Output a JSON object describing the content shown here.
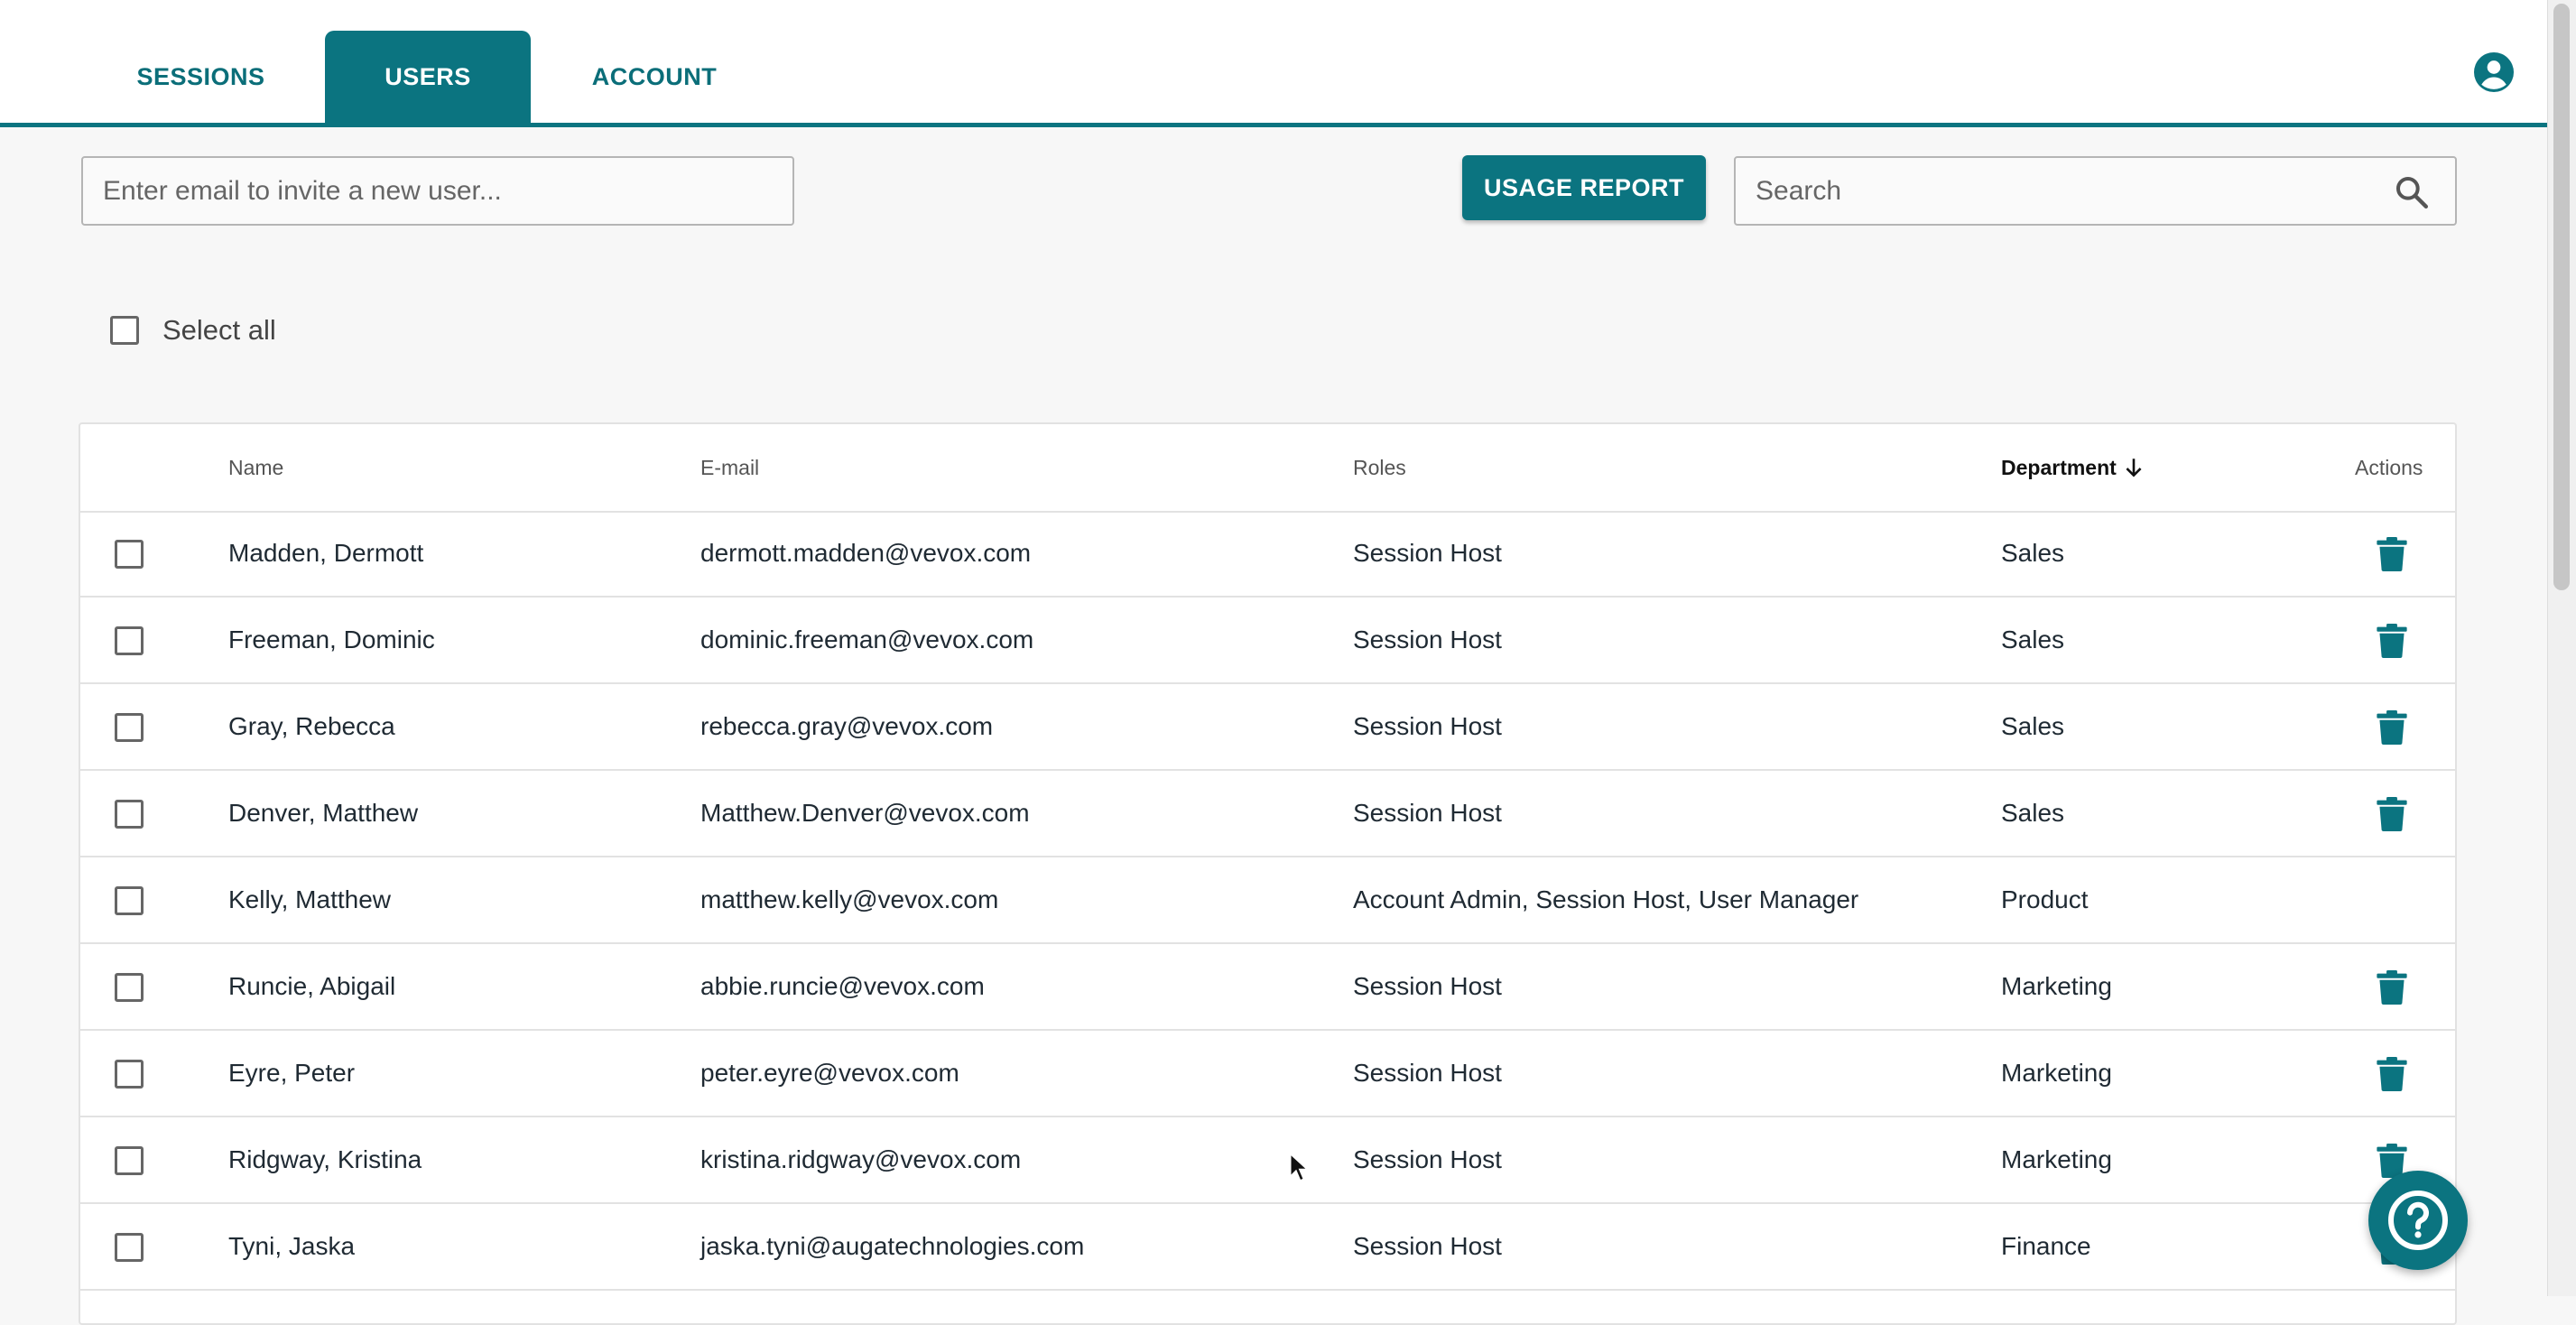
{
  "nav": {
    "tabs": [
      {
        "label": "SESSIONS",
        "active": false
      },
      {
        "label": "USERS",
        "active": true
      },
      {
        "label": "ACCOUNT",
        "active": false
      }
    ],
    "profile_icon": "account-circle-icon"
  },
  "toolbar": {
    "invite_placeholder": "Enter email to invite a new user...",
    "usage_report_label": "USAGE REPORT",
    "search_placeholder": "Search",
    "search_icon": "search-icon"
  },
  "select_all_label": "Select all",
  "table": {
    "headers": {
      "name": "Name",
      "email": "E-mail",
      "roles": "Roles",
      "department": "Department",
      "actions": "Actions"
    },
    "sort": {
      "column": "department",
      "direction": "descending"
    },
    "rows": [
      {
        "name": "Madden, Dermott",
        "email": "dermott.madden@vevox.com",
        "roles": "Session Host",
        "department": "Sales",
        "deletable": true
      },
      {
        "name": "Freeman, Dominic",
        "email": "dominic.freeman@vevox.com",
        "roles": "Session Host",
        "department": "Sales",
        "deletable": true
      },
      {
        "name": "Gray, Rebecca",
        "email": "rebecca.gray@vevox.com",
        "roles": "Session Host",
        "department": "Sales",
        "deletable": true
      },
      {
        "name": "Denver, Matthew",
        "email": "Matthew.Denver@vevox.com",
        "roles": "Session Host",
        "department": "Sales",
        "deletable": true
      },
      {
        "name": "Kelly, Matthew",
        "email": "matthew.kelly@vevox.com",
        "roles": "Account Admin, Session Host, User Manager",
        "department": "Product",
        "deletable": false
      },
      {
        "name": "Runcie, Abigail",
        "email": "abbie.runcie@vevox.com",
        "roles": "Session Host",
        "department": "Marketing",
        "deletable": true
      },
      {
        "name": "Eyre, Peter",
        "email": "peter.eyre@vevox.com",
        "roles": "Session Host",
        "department": "Marketing",
        "deletable": true
      },
      {
        "name": "Ridgway, Kristina",
        "email": "kristina.ridgway@vevox.com",
        "roles": "Session Host",
        "department": "Marketing",
        "deletable": true
      },
      {
        "name": "Tyni, Jaska",
        "email": "jaska.tyni@augatechnologies.com",
        "roles": "Session Host",
        "department": "Finance",
        "deletable": true
      }
    ]
  },
  "help_icon": "help-circle-icon",
  "colors": {
    "accent": "#0b7480",
    "background": "#f7f7f7"
  }
}
